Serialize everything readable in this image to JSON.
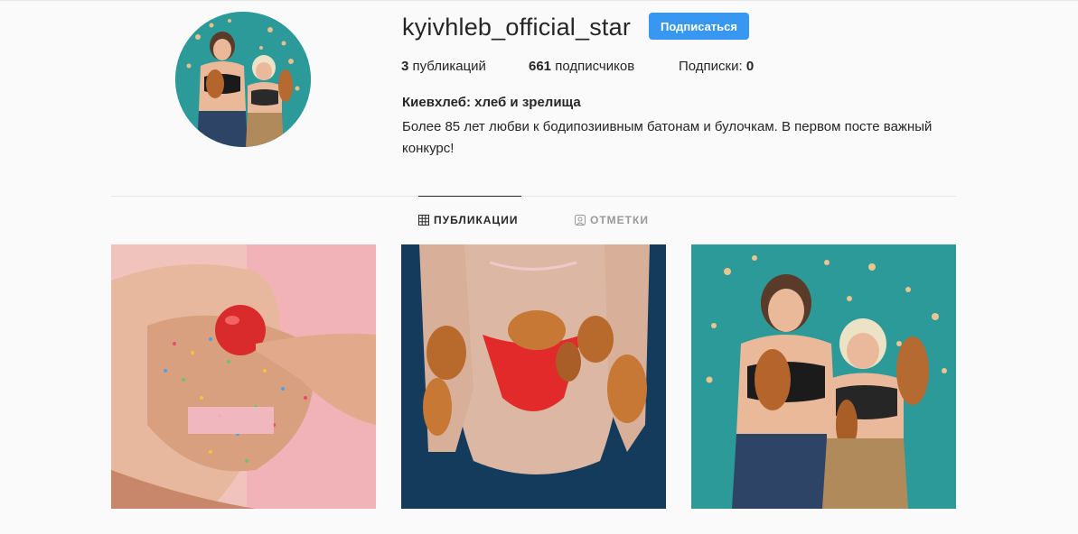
{
  "profile": {
    "username": "kyivhleb_official_star",
    "follow_label": "Подписаться",
    "avatar_alt": "profile-photo",
    "stats": {
      "posts_count": "3",
      "posts_label": "публикаций",
      "followers_count": "661",
      "followers_label": "подписчиков",
      "following_label": "Подписки:",
      "following_count": "0"
    },
    "bio_name": "Киевхлеб: хлеб и зрелища",
    "bio_text": "Более 85 лет любви к бодипозиивным батонам и булочкам. В первом посте важный конкурс!"
  },
  "tabs": [
    {
      "label": "ПУБЛИКАЦИИ",
      "icon": "grid-icon",
      "active": true
    },
    {
      "label": "ОТМЕТКИ",
      "icon": "tagged-icon",
      "active": false
    }
  ],
  "posts": [
    {
      "icon": "photo-sprinkles-apple"
    },
    {
      "icon": "photo-bread-back"
    },
    {
      "icon": "photo-two-women-bread"
    }
  ],
  "colors": {
    "accent": "#3897f0",
    "background": "#fafafa",
    "divider": "#e6e6e6",
    "text": "#262626",
    "muted": "#999999"
  }
}
